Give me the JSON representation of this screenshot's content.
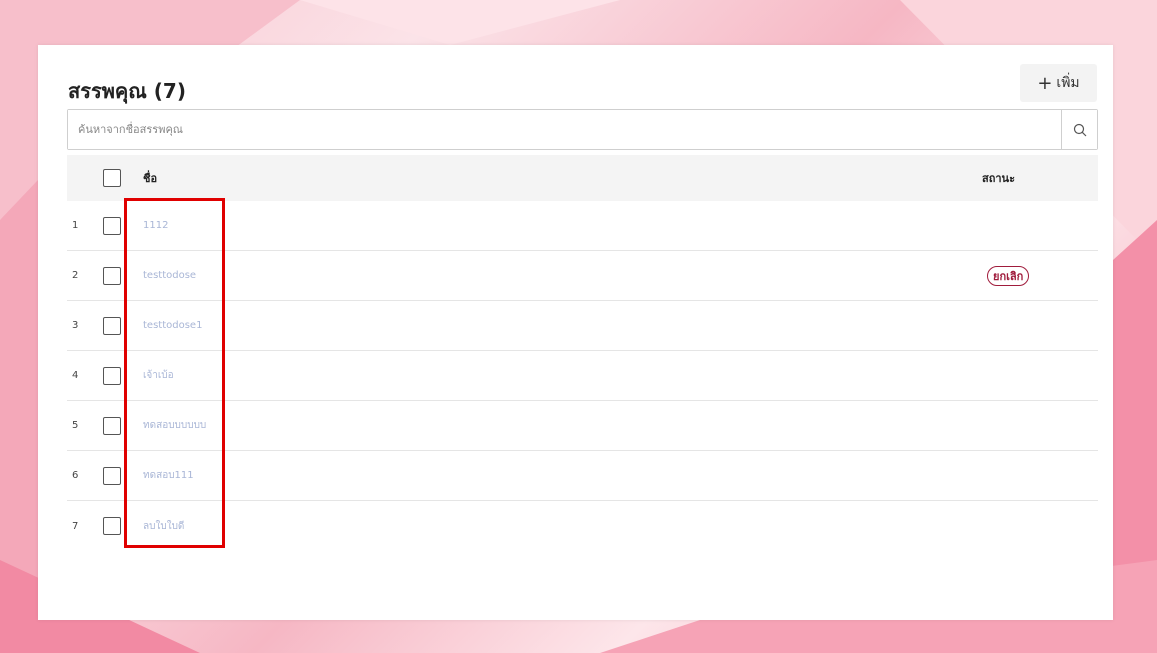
{
  "page": {
    "title": "สรรพคุณ (7)",
    "add_button_label": "เพิ่ม",
    "add_button_icon": "plus-icon"
  },
  "search": {
    "placeholder": "ค้นหาจากชื่อสรรพคุณ",
    "value": "",
    "icon": "search-icon"
  },
  "table": {
    "headers": {
      "name": "ชื่อ",
      "status": "สถานะ"
    },
    "rows": [
      {
        "index": "1",
        "name": "1112",
        "status": ""
      },
      {
        "index": "2",
        "name": "testtodose",
        "status": "ยกเลิก"
      },
      {
        "index": "3",
        "name": "testtodose1",
        "status": ""
      },
      {
        "index": "4",
        "name": "เจ้าเบ้อ",
        "status": ""
      },
      {
        "index": "5",
        "name": "ทดสอบบบบบบ",
        "status": ""
      },
      {
        "index": "6",
        "name": "ทดสอบ111",
        "status": ""
      },
      {
        "index": "7",
        "name": "ลบใบใบดี",
        "status": ""
      }
    ]
  },
  "colors": {
    "highlight": "#e00000",
    "cancel_badge": "#a01c3c",
    "name_text": "#a9b6d6"
  }
}
